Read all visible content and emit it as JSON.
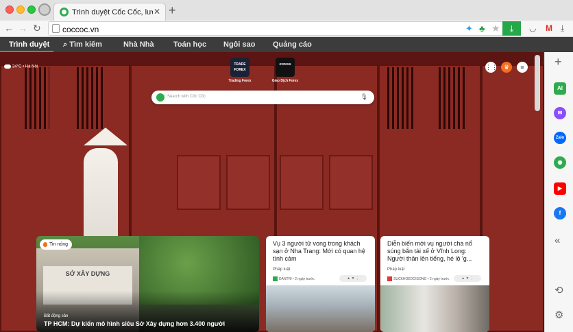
{
  "tab": {
    "title": "Trình duyệt Cốc Cốc, lướt web"
  },
  "address": {
    "url": "coccoc.vn"
  },
  "navstrip": {
    "items": [
      "Trình duyệt",
      "Tìm kiếm",
      "Nhà Nhà",
      "Toán học",
      "Ngôi sao",
      "Quảng cáo"
    ]
  },
  "weather": {
    "text": "34°C • Hà Nội"
  },
  "shortcuts": [
    {
      "label": "Trading Forex",
      "tile_text": "TRADE FOREX"
    },
    {
      "label": "Giao Dịch Forex",
      "tile_text": "exness"
    }
  ],
  "search": {
    "placeholder": "Search with Cốc Cốc"
  },
  "hero": {
    "badge": "Tin nóng",
    "sign_text": "SỞ XÂY DỰNG",
    "category": "Bất động sản",
    "title": "TP HCM: Dự kiến mô hình siêu Sở Xây dựng hơn 3.400 người"
  },
  "cards": [
    {
      "title": "Vụ 3 người tử vong trong khách sạn ở Nha Trang: Mới có quan hệ tình cảm",
      "category": "Pháp luật",
      "source": "DANTRI • 2 ngày trước",
      "source_color": "#2eab4f"
    },
    {
      "title": "Diễn biến mới vụ người cha nổ súng bắn tài xế ở Vĩnh Long: Người thân lên tiếng, hé lộ 'g...",
      "category": "Pháp luật",
      "source": "SUCKHOEDOISONG • 2 ngày trước",
      "source_color": "#e0383c"
    }
  ],
  "colors": {
    "brand_green": "#2eab4f",
    "nav_bg": "#3c3c3c",
    "hot": "#f36f21"
  },
  "sidebar_icons": [
    "plus-icon",
    "ai-icon",
    "messenger-icon",
    "zalo-icon",
    "game-icon",
    "youtube-icon",
    "facebook-icon",
    "collapse-icon",
    "history-icon",
    "settings-icon"
  ]
}
